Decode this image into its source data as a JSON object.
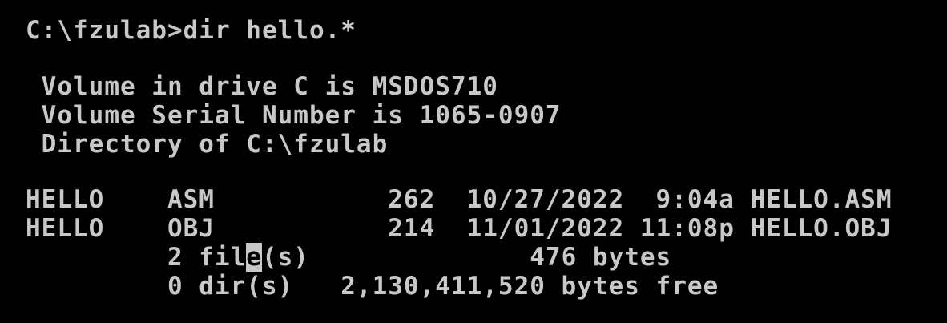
{
  "console": {
    "prompt_line": "C:\\fzulab>dir hello.*",
    "volume_label_line": " Volume in drive C is MSDOS710",
    "serial_line": " Volume Serial Number is 1065-0907",
    "directory_line": " Directory of C:\\fzulab",
    "entries": [
      {
        "text": "HELLO    ASM           262  10/27/2022  9:04a HELLO.ASM"
      },
      {
        "text": "HELLO    OBJ           214  11/01/2022 11:08p HELLO.OBJ"
      }
    ],
    "files_summary": {
      "before_cursor": "         2 fil",
      "cursor_char": "e",
      "after_cursor": "(s)              476 bytes"
    },
    "dirs_summary": "         0 dir(s)   2,130,411,520 bytes free"
  }
}
